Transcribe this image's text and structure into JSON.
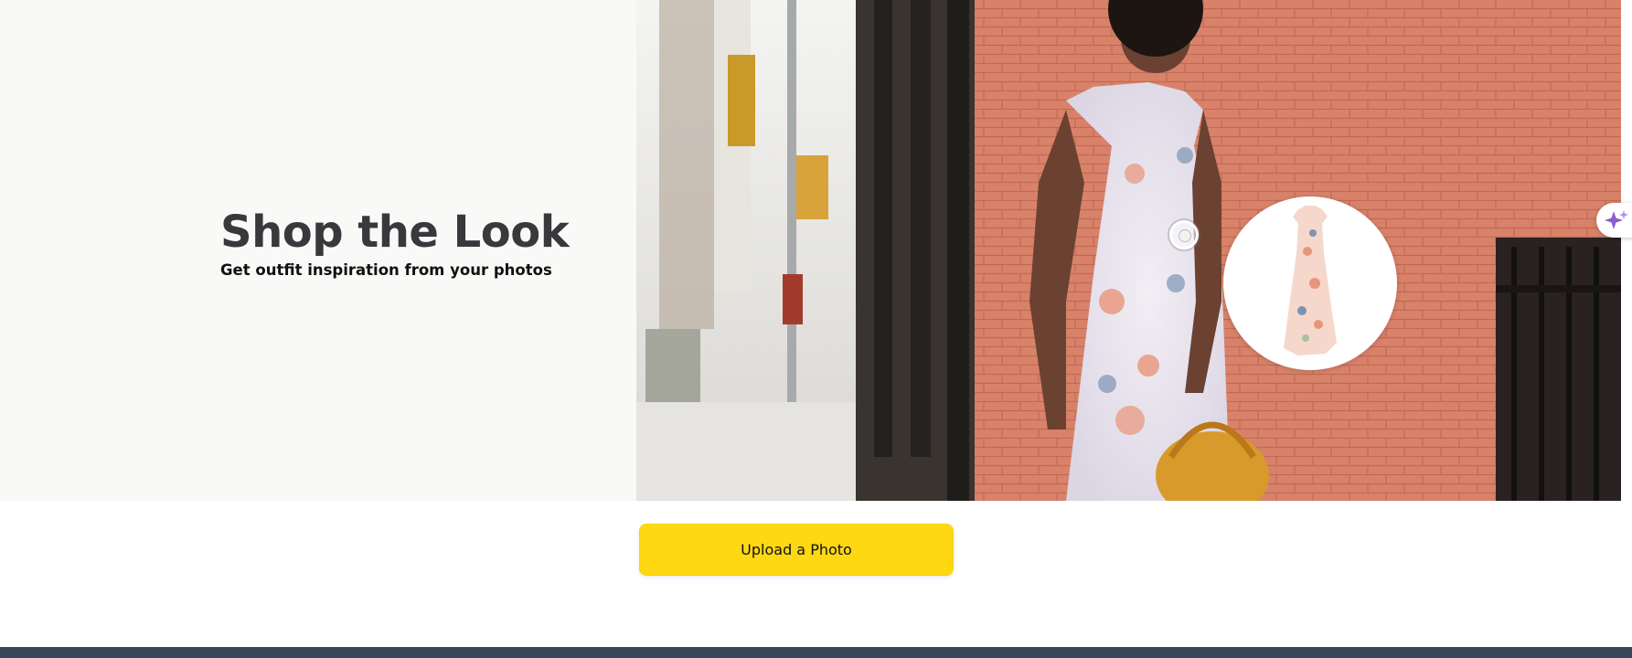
{
  "hero": {
    "title": "Shop the Look",
    "subtitle": "Get outfit inspiration from your photos"
  },
  "upload": {
    "label": "Upload a Photo"
  },
  "icons": {
    "assist": "sparkle-icon",
    "hotspot": "product-hotspot-dot"
  },
  "colors": {
    "hero_background": "#f9f9f7",
    "title_text": "#37393d",
    "button_yellow": "#ffd814",
    "footer_navy": "#37475a",
    "brick": "#d9826a",
    "sparkle_purple": "#8a5cd6"
  }
}
